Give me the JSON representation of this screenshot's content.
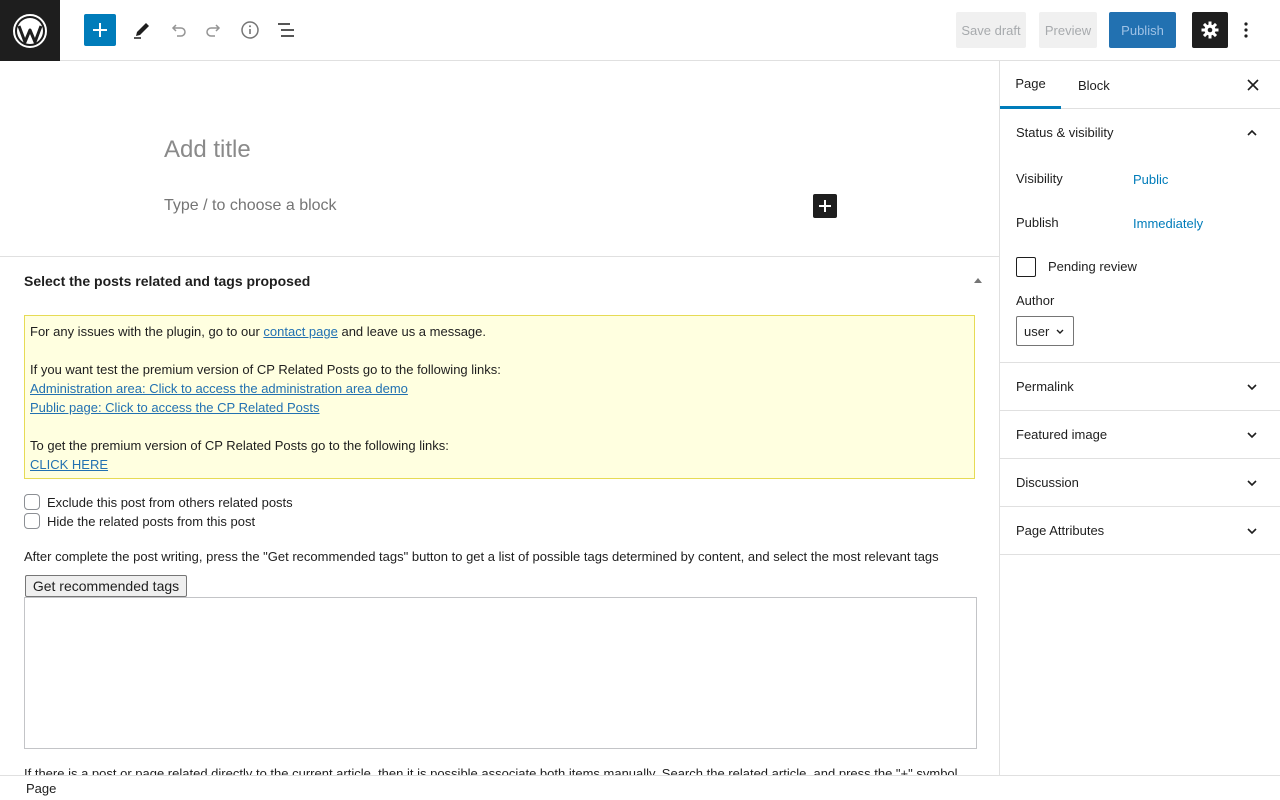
{
  "toolbar": {
    "wp_logo_icon": "wordpress-logo",
    "add_block_icon": "plus-icon",
    "tools_icon": "pencil-icon",
    "undo_icon": "undo-icon",
    "redo_icon": "redo-icon",
    "details_icon": "info-icon",
    "list_view_icon": "list-view-icon",
    "save_draft": "Save draft",
    "preview": "Preview",
    "publish": "Publish",
    "settings_icon": "gear-icon",
    "more_icon": "more-vertical-icon"
  },
  "editor": {
    "title_placeholder": "Add title",
    "block_placeholder": "Type / to choose a block"
  },
  "metabox": {
    "title": "Select the posts related and tags proposed",
    "notice": {
      "line1_pre": "For any issues with the plugin, go to our ",
      "line1_link": "contact page",
      "line1_post": " and leave us a message.",
      "line2": "If you want test the premium version of CP Related Posts go to the following links:",
      "link_admin": "Administration area: Click to access the administration area demo",
      "link_public": "Public page: Click to access the CP Related Posts",
      "line3": "To get the premium version of CP Related Posts go to the following links:",
      "link_click": "CLICK HERE"
    },
    "exclude_label": "Exclude this post from others related posts",
    "hide_label": "Hide the related posts from this post",
    "instructions": "After complete the post writing, press the \"Get recommended tags\" button to get a list of possible tags determined by content, and select the most relevant tags",
    "recommend_button": "Get recommended tags",
    "bottom_text": "If there is a post or page related directly to the current article, then it is possible associate both items manually. Search the related article, and press the \"+\" symbol."
  },
  "sidebar": {
    "tab_page": "Page",
    "tab_block": "Block",
    "status_visibility": "Status & visibility",
    "visibility_label": "Visibility",
    "visibility_value": "Public",
    "publish_label": "Publish",
    "publish_value": "Immediately",
    "pending_review": "Pending review",
    "author_label": "Author",
    "author_value": "user",
    "permalink": "Permalink",
    "featured_image": "Featured image",
    "discussion": "Discussion",
    "page_attributes": "Page Attributes"
  },
  "footer": {
    "breadcrumb": "Page"
  },
  "colors": {
    "accent": "#007cba",
    "dark": "#1e1e1e",
    "notice_bg": "#ffffe0"
  }
}
